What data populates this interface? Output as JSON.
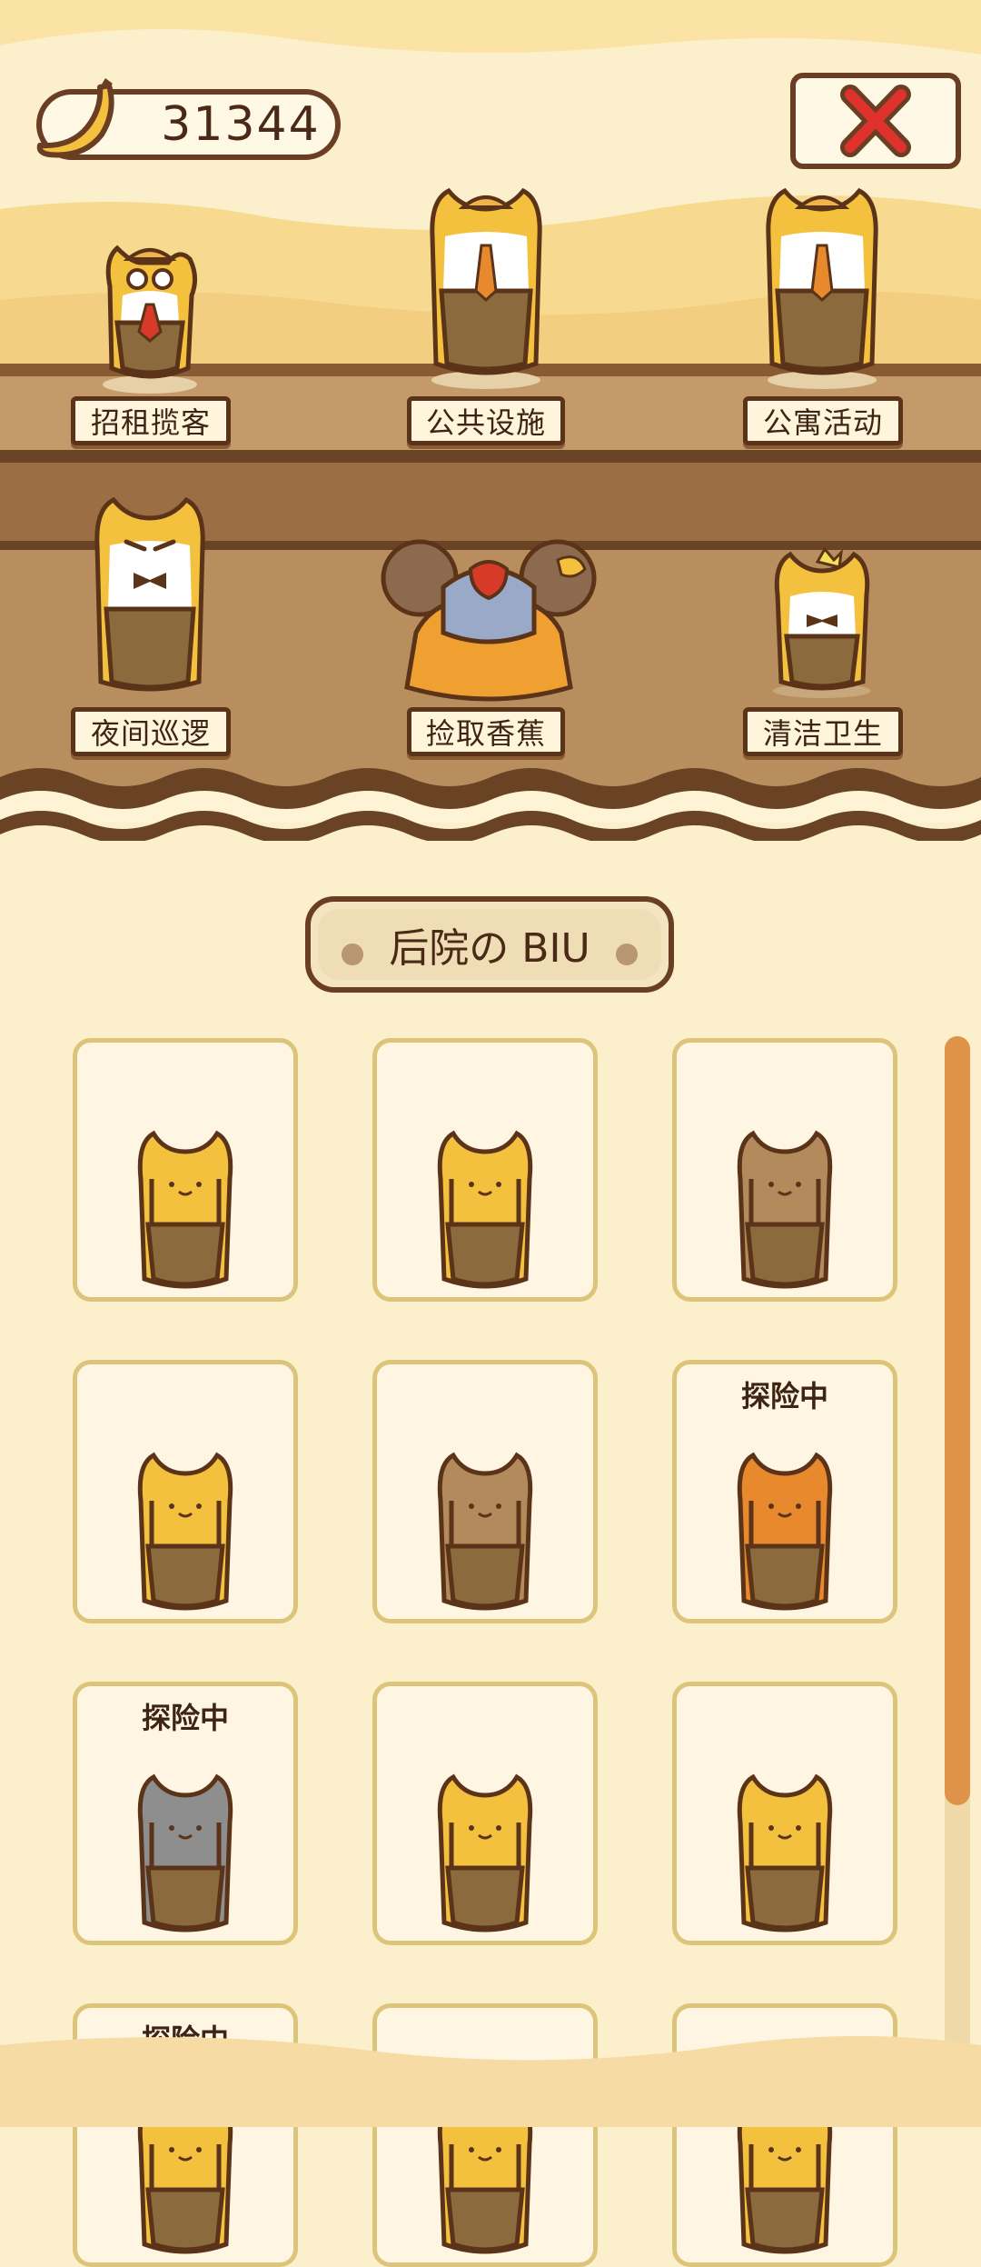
{
  "header": {
    "banana_count": "31344",
    "banana_icon": "banana-icon",
    "close_icon": "close-x-icon"
  },
  "jobs": [
    {
      "label": "招租揽客"
    },
    {
      "label": "公共设施"
    },
    {
      "label": "公寓活动"
    },
    {
      "label": "夜间巡逻"
    },
    {
      "label": "捡取香蕉"
    },
    {
      "label": "清洁卫生"
    }
  ],
  "section": {
    "title": "后院の BIU"
  },
  "cards": [
    {
      "status": ""
    },
    {
      "status": ""
    },
    {
      "status": ""
    },
    {
      "status": ""
    },
    {
      "status": ""
    },
    {
      "status": "探险中"
    },
    {
      "status": "探险中"
    },
    {
      "status": ""
    },
    {
      "status": ""
    },
    {
      "status": "探险中"
    },
    {
      "status": ""
    },
    {
      "status": ""
    }
  ],
  "colors": {
    "outline": "#6A3E22",
    "cream": "#FCEFCB",
    "card_border": "#DCC57A",
    "shelf": "#B98E5F",
    "scroll_thumb": "#DE9348",
    "close_red": "#E0322C"
  }
}
